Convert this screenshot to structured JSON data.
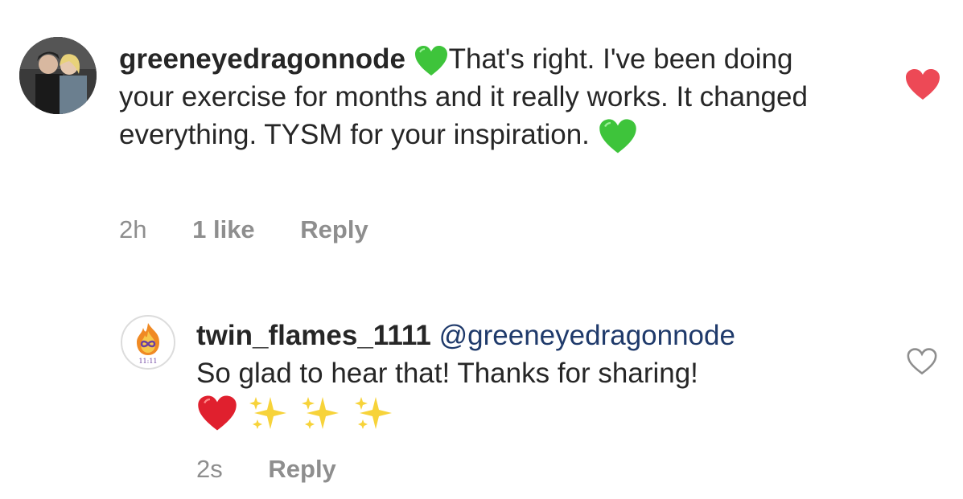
{
  "comments": [
    {
      "username": "greeneyedragonnode",
      "text_part1": "That's right. I've been doing your exercise for months and it really works. It changed everything. TYSM for your inspiration.",
      "time": "2h",
      "likes": "1 like",
      "reply_label": "Reply",
      "liked": true,
      "emoji_inline": "green-heart",
      "emoji_end": "green-heart"
    },
    {
      "username": "twin_flames_1111",
      "mention": "@greeneyedragonnode",
      "text": "So glad to hear that! Thanks for sharing!",
      "time": "2s",
      "reply_label": "Reply",
      "liked": false,
      "avatar_text": "11:11",
      "emojis": [
        "red-heart",
        "sparkles",
        "sparkles",
        "sparkles"
      ]
    }
  ],
  "colors": {
    "liked_heart": "#ed4956",
    "meta_gray": "#8e8e8e",
    "mention_blue": "#1f3a6b",
    "green_heart": "#3ec43b"
  }
}
